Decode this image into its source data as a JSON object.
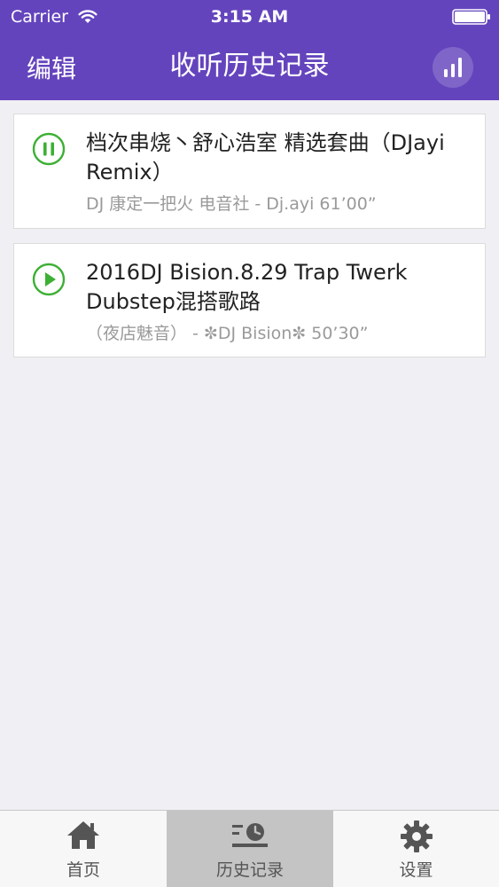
{
  "status_bar": {
    "carrier": "Carrier",
    "time": "3:15 AM"
  },
  "nav": {
    "edit_label": "编辑",
    "title": "收听历史记录",
    "right_icon": "bar-chart-icon"
  },
  "history": [
    {
      "title": "档次串烧丶舒心浩室 精选套曲（DJayi Remix）",
      "meta": "DJ 康定一把火 电音社 - Dj.ayi  61’00”",
      "state": "playing",
      "state_icon": "pause-icon"
    },
    {
      "title": "2016DJ Bision.8.29 Trap Twerk Dubstep混搭歌路",
      "meta": "（夜店魅音） - ✼DJ Bision✼  50’30”",
      "state": "paused",
      "state_icon": "play-icon"
    }
  ],
  "tabs": [
    {
      "label": "首页",
      "icon": "home-icon"
    },
    {
      "label": "历史记录",
      "icon": "history-icon",
      "selected": true
    },
    {
      "label": "设置",
      "icon": "gear-icon"
    }
  ],
  "colors": {
    "header_bg": "#6444bd",
    "accent_green": "#3cb034",
    "page_bg": "#efeff4",
    "tab_selected_bg": "#c4c4c4",
    "meta_text": "#9a9a9a"
  }
}
